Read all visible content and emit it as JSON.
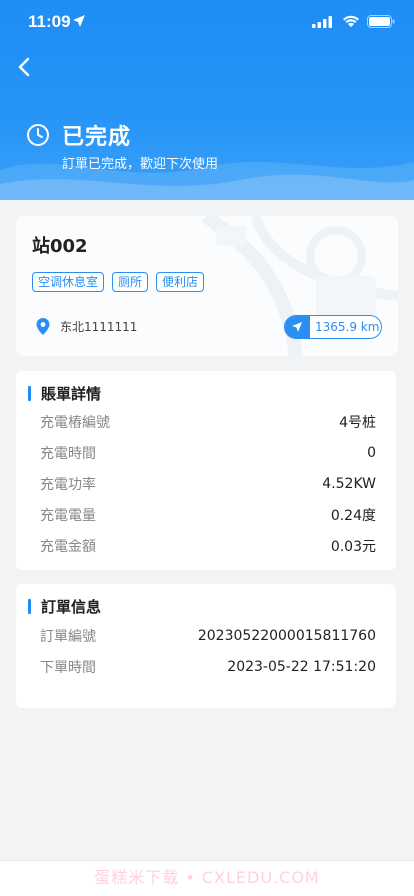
{
  "status_bar": {
    "time": "11:09"
  },
  "header": {
    "status_title": "已完成",
    "status_subtitle": "訂單已完成，歡迎下次使用"
  },
  "station": {
    "name": "站002",
    "tags": [
      "空调休息室",
      "厕所",
      "便利店"
    ],
    "address": "东北1111111",
    "distance": "1365.9 km"
  },
  "bill": {
    "title": "賬單詳情",
    "rows": [
      {
        "label": "充電樁編號",
        "value": "4号桩"
      },
      {
        "label": "充電時間",
        "value": "0"
      },
      {
        "label": "充電功率",
        "value": "4.52KW"
      },
      {
        "label": "充電電量",
        "value": "0.24度"
      },
      {
        "label": "充電金額",
        "value": "0.03元"
      }
    ]
  },
  "order": {
    "title": "訂單信息",
    "rows": [
      {
        "label": "訂單編號",
        "value": "20230522000015811760"
      },
      {
        "label": "下單時間",
        "value": "2023-05-22 17:51:20"
      }
    ]
  },
  "watermark": "蛋糕米下载 • CXLEDU.COM",
  "colors": {
    "accent": "#1e8df5",
    "tag_blue": "#2a8ef2",
    "background": "#f2f3f5"
  }
}
